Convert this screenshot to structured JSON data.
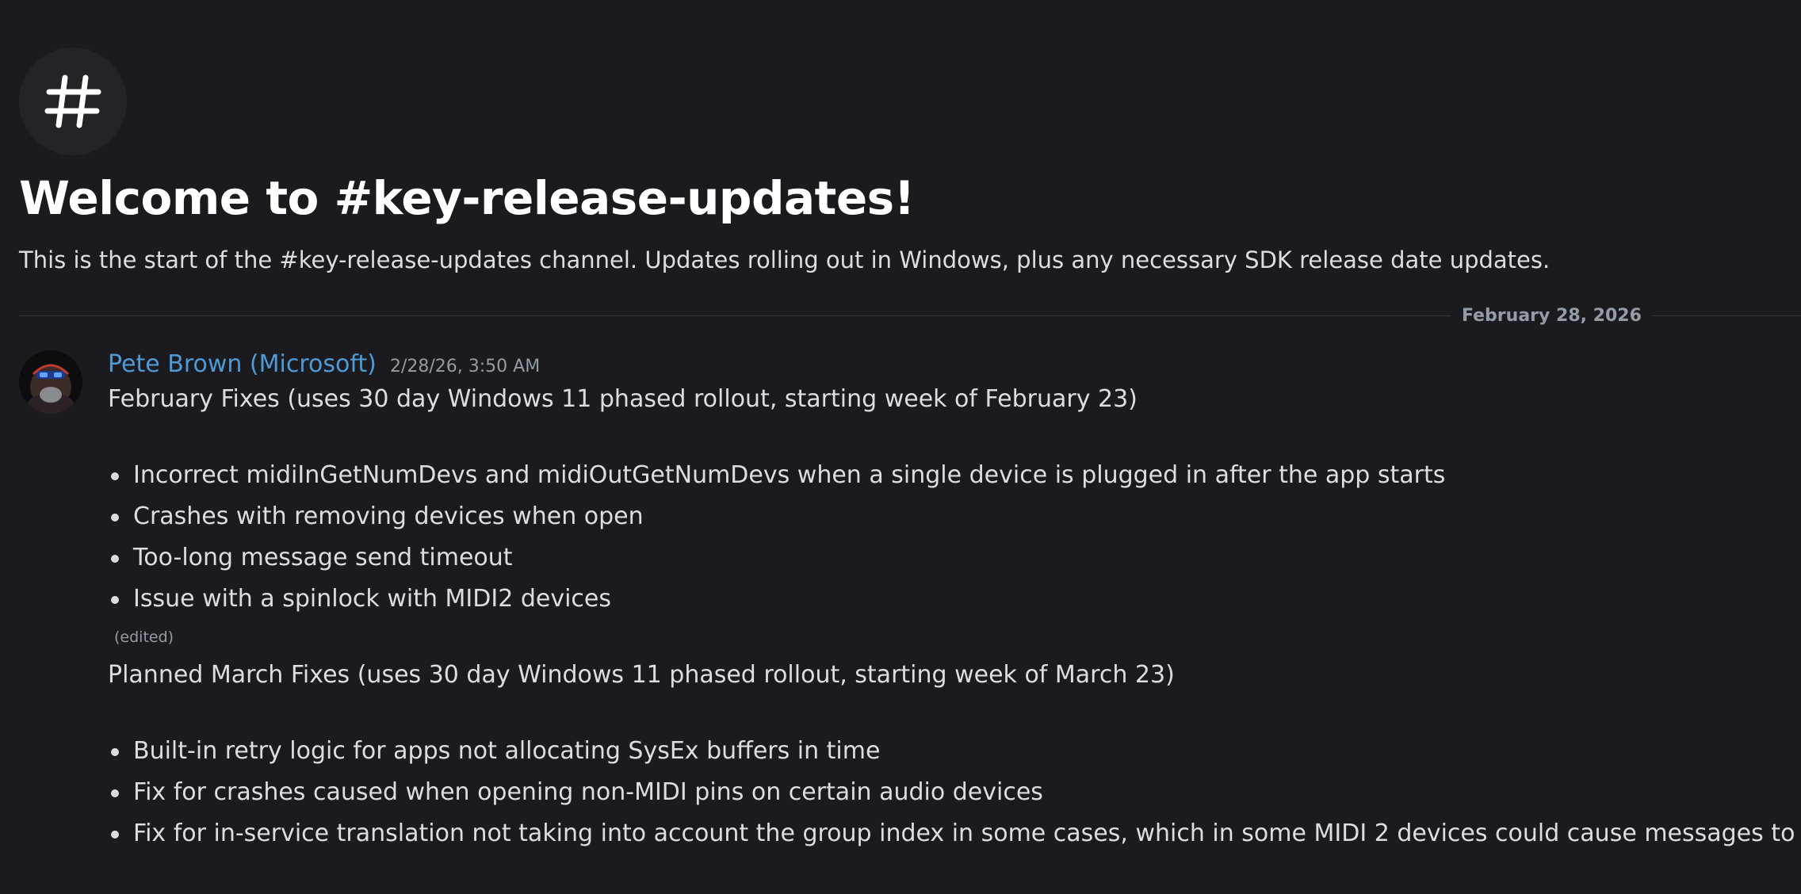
{
  "channel": {
    "icon": "hashtag-icon",
    "welcome_title": "Welcome to #key-release-updates!",
    "description": "This is the start of the #key-release-updates channel. Updates rolling out in Windows, plus any necessary SDK release date updates."
  },
  "date_divider": "February 28, 2026",
  "message": {
    "author": "Pete Brown (Microsoft)",
    "author_color": "#4e9ad6",
    "timestamp": "2/28/26, 3:50 AM",
    "avatar": "user-avatar",
    "section1_heading": "February Fixes (uses 30 day Windows 11 phased rollout, starting week of February 23)",
    "section1_items": [
      "Incorrect midiInGetNumDevs and midiOutGetNumDevs when a single device is plugged in after the app starts",
      "Crashes with removing devices when open",
      "Too-long message send timeout",
      "Issue with a spinlock with MIDI2 devices"
    ],
    "edited_label": "(edited)",
    "section2_heading": "Planned March Fixes (uses 30 day Windows 11 phased rollout, starting week of March 23)",
    "section2_items": [
      "Built-in retry logic for apps not allocating SysEx buffers in time",
      "Fix for crashes caused when opening non-MIDI pins on certain audio devices",
      "Fix for in-service translation not taking into account the group index in some cases, which in some MIDI 2 devices could cause messages to cross."
    ]
  }
}
